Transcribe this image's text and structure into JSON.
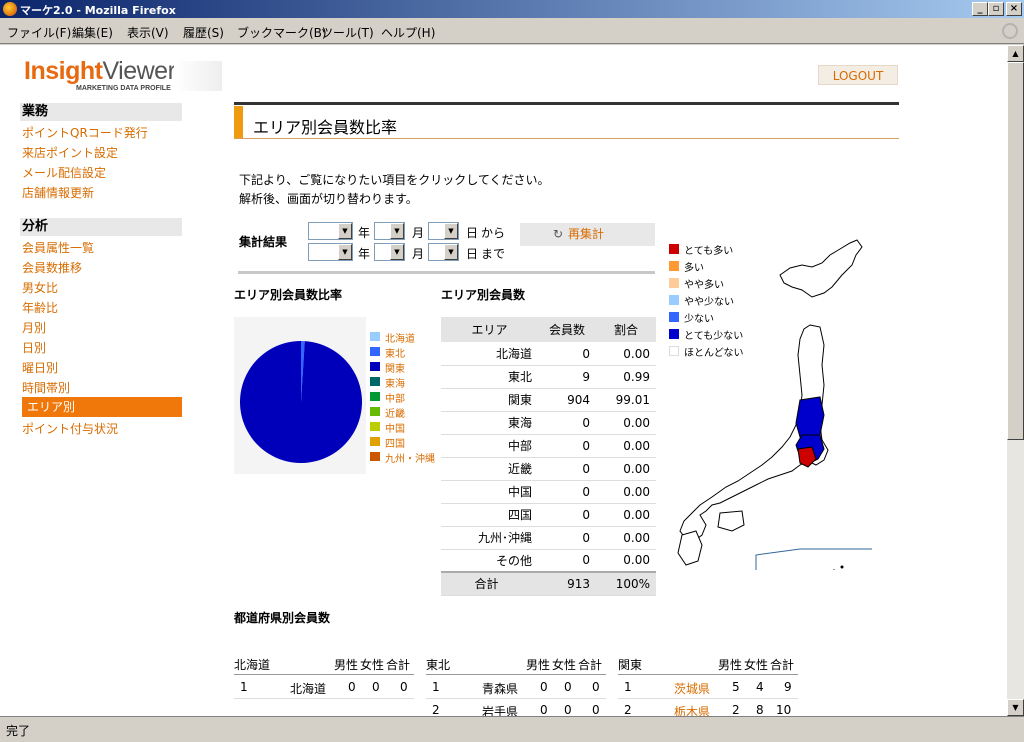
{
  "window": {
    "title": "マーケ2.0 - Mozilla Firefox"
  },
  "menu": {
    "items": [
      "ファイル(F)",
      "編集(E)",
      "表示(V)",
      "履歴(S)",
      "ブックマーク(B)",
      "ツール(T)",
      "ヘルプ(H)"
    ]
  },
  "status": {
    "text": "完了"
  },
  "logo": {
    "word1": "Insight",
    "word2": "Viewer",
    "sub": "MARKETING DATA PROFILE"
  },
  "logout": "LOGOUT",
  "nav": {
    "section1": "業務",
    "items1": [
      "ポイントQRコード発行",
      "来店ポイント設定",
      "メール配信設定",
      "店舗情報更新"
    ],
    "section2": "分析",
    "items2": [
      "会員属性一覧",
      "会員数推移",
      "男女比",
      "年齢比",
      "月別",
      "日別",
      "曜日別",
      "時間帯別",
      "エリア別",
      "ポイント付与状況"
    ]
  },
  "page": {
    "title": "エリア別会員数比率",
    "intro1": "下記より、ご覧になりたい項目をクリックしてください。",
    "intro2": "解析後、画面が切り替わります。"
  },
  "filter": {
    "label": "集計結果",
    "year": "年",
    "month": "月",
    "day": "日",
    "from": "から",
    "to": "まで",
    "recalc": "再集計"
  },
  "pie": {
    "title": "エリア別会員数比率",
    "legend": [
      {
        "label": "北海道",
        "color": "#99ccff"
      },
      {
        "label": "東北",
        "color": "#3366ff"
      },
      {
        "label": "関東",
        "color": "#0000bb"
      },
      {
        "label": "東海",
        "color": "#006666"
      },
      {
        "label": "中部",
        "color": "#009933"
      },
      {
        "label": "近畿",
        "color": "#66bb00"
      },
      {
        "label": "中国",
        "color": "#bbcc00"
      },
      {
        "label": "四国",
        "color": "#e0a000"
      },
      {
        "label": "九州・沖縄",
        "color": "#cc5500"
      }
    ]
  },
  "chart_data": {
    "type": "pie",
    "categories": [
      "北海道",
      "東北",
      "関東",
      "東海",
      "中部",
      "近畿",
      "中国",
      "四国",
      "九州・沖縄",
      "その他"
    ],
    "values": [
      0,
      9,
      904,
      0,
      0,
      0,
      0,
      0,
      0,
      0
    ]
  },
  "areaTable": {
    "title": "エリア別会員数",
    "headers": [
      "エリア",
      "会員数",
      "割合"
    ],
    "rows": [
      [
        "北海道",
        "0",
        "0.00"
      ],
      [
        "東北",
        "9",
        "0.99"
      ],
      [
        "関東",
        "904",
        "99.01"
      ],
      [
        "東海",
        "0",
        "0.00"
      ],
      [
        "中部",
        "0",
        "0.00"
      ],
      [
        "近畿",
        "0",
        "0.00"
      ],
      [
        "中国",
        "0",
        "0.00"
      ],
      [
        "四国",
        "0",
        "0.00"
      ],
      [
        "九州･沖縄",
        "0",
        "0.00"
      ],
      [
        "その他",
        "0",
        "0.00"
      ]
    ],
    "total": [
      "合計",
      "913",
      "100%"
    ]
  },
  "mapLegend": [
    {
      "label": "とても多い",
      "color": "#cc0000"
    },
    {
      "label": "多い",
      "color": "#ff9933"
    },
    {
      "label": "やや多い",
      "color": "#ffcc99"
    },
    {
      "label": "やや少ない",
      "color": "#99ccff"
    },
    {
      "label": "少ない",
      "color": "#3366ff"
    },
    {
      "label": "とても少ない",
      "color": "#0000cc"
    },
    {
      "label": "ほとんどない",
      "color": "#ffffff"
    }
  ],
  "prefSection": {
    "title": "都道府県別会員数"
  },
  "prefTables": [
    {
      "area": "北海道",
      "cols": [
        "男性",
        "女性",
        "合計"
      ],
      "rows": [
        {
          "no": "1",
          "name": "北海道",
          "m": "0",
          "f": "0",
          "t": "0",
          "link": false
        }
      ]
    },
    {
      "area": "東北",
      "cols": [
        "男性",
        "女性",
        "合計"
      ],
      "rows": [
        {
          "no": "1",
          "name": "青森県",
          "m": "0",
          "f": "0",
          "t": "0",
          "link": false
        },
        {
          "no": "2",
          "name": "岩手県",
          "m": "0",
          "f": "0",
          "t": "0",
          "link": false
        }
      ]
    },
    {
      "area": "関東",
      "cols": [
        "男性",
        "女性",
        "合計"
      ],
      "rows": [
        {
          "no": "1",
          "name": "茨城県",
          "m": "5",
          "f": "4",
          "t": "9",
          "link": true
        },
        {
          "no": "2",
          "name": "栃木県",
          "m": "2",
          "f": "8",
          "t": "10",
          "link": true
        }
      ]
    }
  ]
}
